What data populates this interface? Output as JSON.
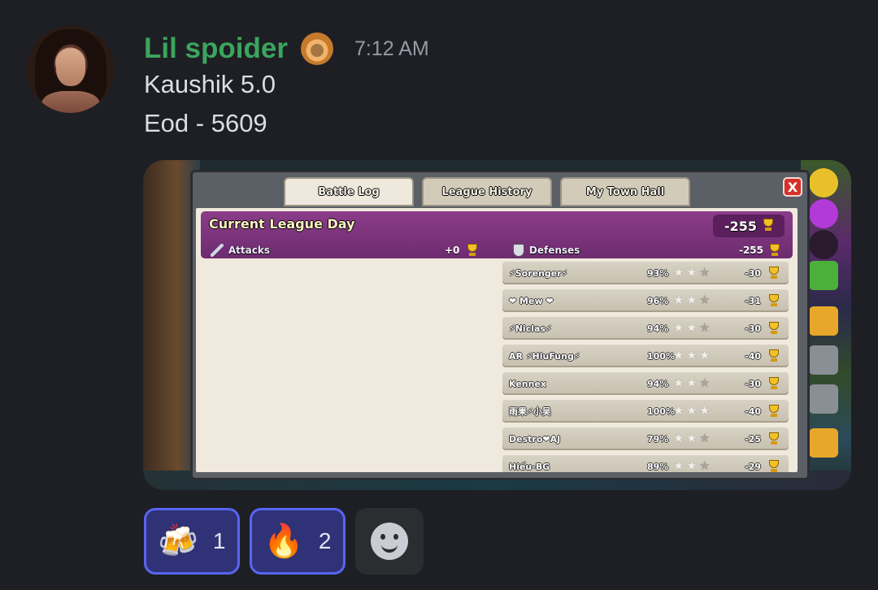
{
  "message": {
    "username": "Lil spoider",
    "timestamp": "7:12 AM",
    "lines": [
      "Kaushik 5.0",
      "Eod - 5609"
    ]
  },
  "game": {
    "tabs": [
      "Battle Log",
      "League History",
      "My Town Hall"
    ],
    "active_tab": "Battle Log",
    "close_label": "X",
    "league_title": "Current League Day",
    "league_total": "-255",
    "attacks_label": "Attacks",
    "attacks_value": "+0",
    "defenses_label": "Defenses",
    "defenses_value": "-255",
    "defenses": [
      {
        "name": "⚡Sorenger⚡",
        "percent": "93%",
        "stars": 2,
        "trophies": "-30"
      },
      {
        "name": "❤ Mew ❤",
        "percent": "96%",
        "stars": 2,
        "trophies": "-31"
      },
      {
        "name": "⚡Niclas⚡",
        "percent": "94%",
        "stars": 2,
        "trophies": "-30"
      },
      {
        "name": "AR ⚡HiuFung⚡",
        "percent": "100%",
        "stars": 3,
        "trophies": "-40"
      },
      {
        "name": "Kennex",
        "percent": "94%",
        "stars": 2,
        "trophies": "-30"
      },
      {
        "name": "雨果⚡小吴",
        "percent": "100%",
        "stars": 3,
        "trophies": "-40"
      },
      {
        "name": "Destro❤AJ",
        "percent": "79%",
        "stars": 2,
        "trophies": "-25"
      },
      {
        "name": "Hiếu-BG",
        "percent": "89%",
        "stars": 2,
        "trophies": "-29"
      }
    ]
  },
  "reactions": [
    {
      "emoji": "🍻",
      "count": "1"
    },
    {
      "emoji": "🔥",
      "count": "2"
    }
  ],
  "icons": {
    "add_reaction": "smile-plus-icon",
    "role": "fire-face-icon",
    "attacks": "sword-icon",
    "defenses": "shield-icon",
    "trophy": "trophy-icon"
  },
  "colors": {
    "background": "#1e1f24",
    "username": "#3ba55d",
    "reaction_border": "#5865f2",
    "league_bar": "#7a3479"
  }
}
